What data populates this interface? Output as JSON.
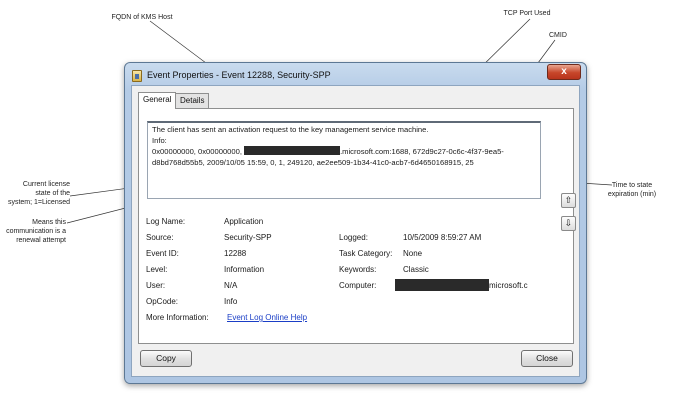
{
  "callouts": {
    "fqdn": "FQDN of KMS Host",
    "tcp_port": "TCP Port Used",
    "cmid": "CMID",
    "license_state": [
      "Current license",
      "state of the",
      "system; 1=Licensed"
    ],
    "renewal": [
      "Means this",
      "communication is a",
      "renewal attempt"
    ],
    "time_to_state": [
      "Time to state",
      "expiration (min)"
    ]
  },
  "window": {
    "title": "Event Properties - Event 12288, Security-SPP",
    "close_label": "x"
  },
  "tabs": [
    {
      "label": "General",
      "active": true
    },
    {
      "label": "Details",
      "active": false
    }
  ],
  "message": {
    "line1": "The client has sent an activation request to the key management service machine.",
    "line2": "Info:",
    "line3a": "0x00000000, 0x00000000, ",
    "line3b": ".microsoft.com:1688, 672d9c27-0c6c-4f37-9ea5-",
    "line4": "d8bd768d55b5, 2009/10/05 15:59, 0, 1, 249120, ae2ee509-1b34-41c0-acb7-6d4650168915, 25"
  },
  "scroll_buttons": {
    "up_icon": "arrow-up-icon",
    "down_icon": "arrow-down-icon",
    "up": "⇧",
    "down": "⇩"
  },
  "fields": {
    "log_name": {
      "label": "Log Name:",
      "value": "Application"
    },
    "source": {
      "label": "Source:",
      "value": "Security-SPP"
    },
    "logged": {
      "label": "Logged:",
      "value": "10/5/2009 8:59:27 AM"
    },
    "event_id": {
      "label": "Event ID:",
      "value": "12288"
    },
    "task_category": {
      "label": "Task Category:",
      "value": "None"
    },
    "level": {
      "label": "Level:",
      "value": "Information"
    },
    "keywords": {
      "label": "Keywords:",
      "value": "Classic"
    },
    "user": {
      "label": "User:",
      "value": "N/A"
    },
    "computer": {
      "label": "Computer:",
      "value": "microsoft.c"
    },
    "opcode": {
      "label": "OpCode:",
      "value": "Info"
    },
    "more_info": {
      "label": "More Information:",
      "link": "Event Log Online Help"
    }
  },
  "buttons": {
    "copy": "Copy",
    "close": "Close"
  },
  "colors": {
    "redaction": "#2a2a2a",
    "link": "#1a3ec6",
    "close_button": "#c7462a"
  }
}
